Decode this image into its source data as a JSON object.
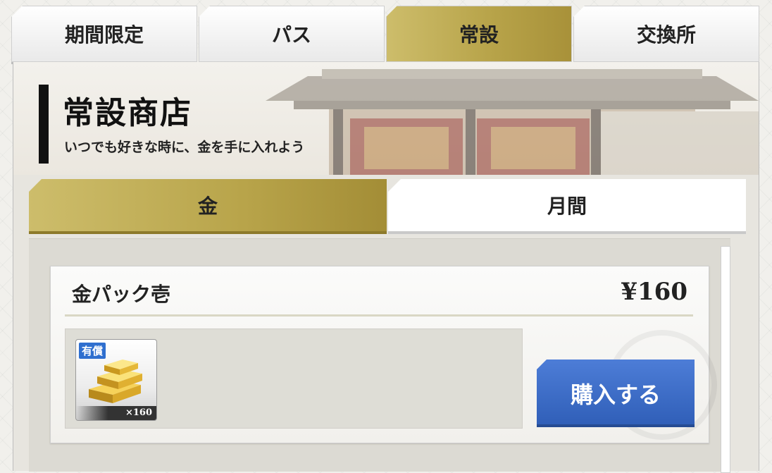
{
  "top_tabs": [
    {
      "label": "期間限定",
      "active": false
    },
    {
      "label": "パス",
      "active": false
    },
    {
      "label": "常設",
      "active": true
    },
    {
      "label": "交換所",
      "active": false
    }
  ],
  "hero": {
    "title": "常設商店",
    "subtitle": "いつでも好きな時に、金を手に入れよう"
  },
  "sub_tabs": [
    {
      "label": "金",
      "active": true
    },
    {
      "label": "月間",
      "active": false
    }
  ],
  "product": {
    "name": "金パック壱",
    "price": "¥160",
    "badge": "有償",
    "quantity": "×160",
    "icon": "gold-bars-icon",
    "buy_label": "購入する"
  },
  "colors": {
    "active_gold": "#b8a44a",
    "buy_blue": "#2f5eb7",
    "badge_blue": "#2f6fcf"
  }
}
